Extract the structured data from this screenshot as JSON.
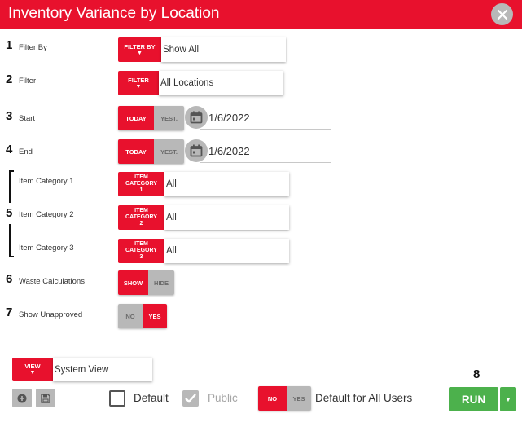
{
  "window": {
    "title": "Inventory Variance by Location"
  },
  "rows": {
    "filter_by": {
      "num": "1",
      "label": "Filter By",
      "button": "FILTER BY",
      "arrow": "▼",
      "value": "Show All"
    },
    "filter": {
      "num": "2",
      "label": "Filter",
      "button": "FILTER",
      "arrow": "▼",
      "value": "All Locations"
    },
    "start": {
      "num": "3",
      "label": "Start",
      "today": "TODAY",
      "yest": "YEST.",
      "date": "1/6/2022"
    },
    "end": {
      "num": "4",
      "label": "End",
      "today": "TODAY",
      "yest": "YEST.",
      "date": "1/6/2022"
    },
    "category_group_num": "5",
    "cat1": {
      "label": "Item Category 1",
      "button_l1": "ITEM",
      "button_l2": "CATEGORY",
      "button_l3": "1",
      "value": "All"
    },
    "cat2": {
      "label": "Item Category 2",
      "button_l1": "ITEM",
      "button_l2": "CATEGORY",
      "button_l3": "2",
      "value": "All"
    },
    "cat3": {
      "label": "Item Category 3",
      "button_l1": "ITEM",
      "button_l2": "CATEGORY",
      "button_l3": "3",
      "value": "All"
    },
    "waste": {
      "num": "6",
      "label": "Waste Calculations",
      "on": "SHOW",
      "off": "HIDE",
      "selected": "SHOW"
    },
    "unapproved": {
      "num": "7",
      "label": "Show Unapproved",
      "off": "NO",
      "on": "YES",
      "selected": "YES"
    }
  },
  "footer": {
    "view_button": "VIEW",
    "view_arrow": "▼",
    "view_value": "System View",
    "default_label": "Default",
    "default_checked": false,
    "public_label": "Public",
    "public_checked": true,
    "default_all_no": "NO",
    "default_all_yes": "YES",
    "default_all_selected": "NO",
    "default_all_label": "Default for All Users",
    "run_num": "8",
    "run_label": "RUN",
    "run_caret": "▼"
  },
  "icons": {
    "close": "close-icon",
    "calendar": "calendar-icon",
    "add": "add-circle-icon",
    "save": "save-icon",
    "check": "checkmark-icon"
  },
  "colors": {
    "accent": "#e8112d",
    "inactive": "#b8b8b8",
    "run": "#4cb14c"
  }
}
